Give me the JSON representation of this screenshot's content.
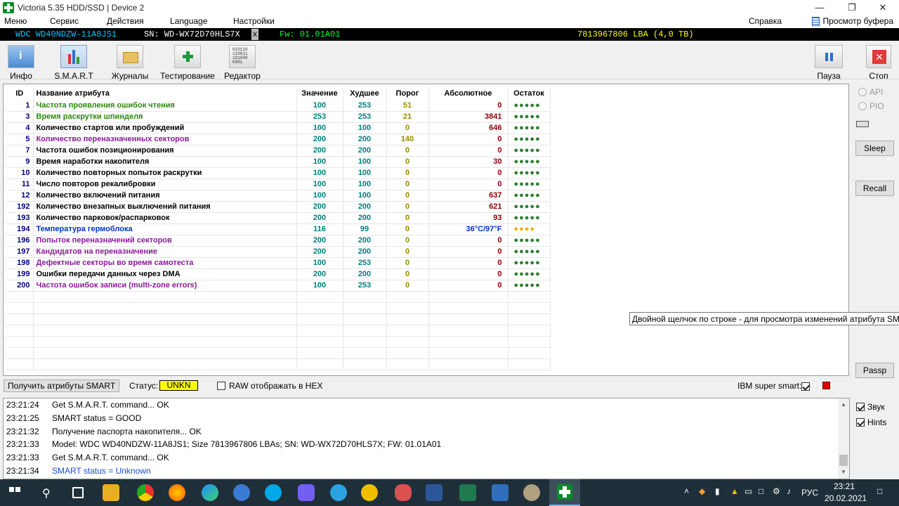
{
  "window": {
    "title": "Victoria 5.35 HDD/SSD | Device 2"
  },
  "menu": {
    "items": [
      "Меню",
      "Сервис",
      "Действия",
      "Language",
      "Настройки",
      "Справка"
    ],
    "viewer": "Просмотр буфера"
  },
  "device": {
    "model": "WDC WD40NDZW-11A8JS1",
    "serial": "SN: WD-WX72D70HLS7X",
    "close": "x",
    "firmware": "Fw: 01.01A01",
    "lba": "7813967806 LBA (4,0 TB)"
  },
  "toolbar": {
    "info": "Инфо",
    "smart": "S.M.A.R.T",
    "logs": "Журналы",
    "testing": "Тестирование",
    "editor": "Редактор",
    "pause": "Пауза",
    "stop": "Стоп"
  },
  "table": {
    "headers": [
      "ID",
      "Название атрибута",
      "Значение",
      "Худшее",
      "Порог",
      "Абсолютное",
      "Остаток"
    ],
    "rows": [
      {
        "id": "1",
        "name": "Частота проявления ошибок чтения",
        "color": "green",
        "value": "100",
        "worst": "253",
        "threshold": "51",
        "raw": "0",
        "remain": "●●●●●"
      },
      {
        "id": "3",
        "name": "Время раскрутки шпинделя",
        "color": "green",
        "value": "253",
        "worst": "253",
        "threshold": "21",
        "raw": "3841",
        "remain": "●●●●●"
      },
      {
        "id": "4",
        "name": "Количество стартов или пробуждений",
        "color": "black",
        "value": "100",
        "worst": "100",
        "threshold": "0",
        "raw": "646",
        "remain": "●●●●●"
      },
      {
        "id": "5",
        "name": "Количество переназначенных секторов",
        "color": "purple",
        "value": "200",
        "worst": "200",
        "threshold": "140",
        "raw": "0",
        "remain": "●●●●●"
      },
      {
        "id": "7",
        "name": "Частота ошибок позиционирования",
        "color": "black",
        "value": "200",
        "worst": "200",
        "threshold": "0",
        "raw": "0",
        "remain": "●●●●●"
      },
      {
        "id": "9",
        "name": "Время наработки накопителя",
        "color": "black",
        "value": "100",
        "worst": "100",
        "threshold": "0",
        "raw": "30",
        "remain": "●●●●●"
      },
      {
        "id": "10",
        "name": "Количество повторных попыток раскрутки",
        "color": "black",
        "value": "100",
        "worst": "100",
        "threshold": "0",
        "raw": "0",
        "remain": "●●●●●"
      },
      {
        "id": "11",
        "name": "Число повторов рекалибровки",
        "color": "black",
        "value": "100",
        "worst": "100",
        "threshold": "0",
        "raw": "0",
        "remain": "●●●●●"
      },
      {
        "id": "12",
        "name": "Количество включений питания",
        "color": "black",
        "value": "100",
        "worst": "100",
        "threshold": "0",
        "raw": "637",
        "remain": "●●●●●"
      },
      {
        "id": "192",
        "name": "Количество внезапных выключений питания",
        "color": "black",
        "value": "200",
        "worst": "200",
        "threshold": "0",
        "raw": "621",
        "remain": "●●●●●"
      },
      {
        "id": "193",
        "name": "Количество парковок/распарковок",
        "color": "black",
        "value": "200",
        "worst": "200",
        "threshold": "0",
        "raw": "93",
        "remain": "●●●●●"
      },
      {
        "id": "194",
        "name": "Температура гермоблока",
        "color": "blue",
        "value": "116",
        "worst": "99",
        "threshold": "0",
        "raw": "36°C/97°F",
        "remain": "●●●●"
      },
      {
        "id": "196",
        "name": "Попыток переназначений секторов",
        "color": "purple",
        "value": "200",
        "worst": "200",
        "threshold": "0",
        "raw": "0",
        "remain": "●●●●●"
      },
      {
        "id": "197",
        "name": "Кандидатов на переназначение",
        "color": "purple",
        "value": "200",
        "worst": "200",
        "threshold": "0",
        "raw": "0",
        "remain": "●●●●●"
      },
      {
        "id": "198",
        "name": "Дефектные секторы во время самотеста",
        "color": "purple",
        "value": "100",
        "worst": "253",
        "threshold": "0",
        "raw": "0",
        "remain": "●●●●●"
      },
      {
        "id": "199",
        "name": "Ошибки передачи данных через DMA",
        "color": "black",
        "value": "200",
        "worst": "200",
        "threshold": "0",
        "raw": "0",
        "remain": "●●●●●"
      },
      {
        "id": "200",
        "name": "Частота ошибок записи (multi-zone errors)",
        "color": "purple",
        "value": "100",
        "worst": "253",
        "threshold": "0",
        "raw": "0",
        "remain": "●●●●●"
      }
    ]
  },
  "right_panel": {
    "api": "API",
    "pio": "PIO",
    "sleep": "Sleep",
    "recall": "Recall",
    "passp": "Passp"
  },
  "tooltip": "Двойной щелчок по строке - для просмотра изменений атрибута SMART",
  "statusbar": {
    "get_smart": "Получить атрибуты SMART",
    "status_label": "Статус:",
    "status_value": "UNKN",
    "raw_hex": "RAW отображать в HEX",
    "ibm_label": "IBM super smart:"
  },
  "log": [
    {
      "time": "23:21:24",
      "text": "Get S.M.A.R.T. command... OK",
      "color": "#000000"
    },
    {
      "time": "23:21:25",
      "text": "SMART status = GOOD",
      "color": "#000000"
    },
    {
      "time": "23:21:32",
      "text": "Получение паспорта накопителя... OK",
      "color": "#000000"
    },
    {
      "time": "23:21:33",
      "text": "Model: WDC WD40NDZW-11A8JS1; Size 7813967806 LBAs; SN: WD-WX72D70HLS7X; FW: 01.01A01",
      "color": "#000000"
    },
    {
      "time": "23:21:33",
      "text": "Get S.M.A.R.T. command... OK",
      "color": "#000000"
    },
    {
      "time": "23:21:34",
      "text": "SMART status = Unknown",
      "color": "#1a4fd8"
    }
  ],
  "side_options": {
    "sound": "Звук",
    "hints": "Hints"
  },
  "taskbar": {
    "lang": "РУС",
    "time": "23:21",
    "date": "20.02.2021"
  },
  "colors": {
    "status_badge": "#ffff00",
    "accent_green": "#0a8a2a",
    "device_model": "#00c8ff",
    "device_firmware": "#00ff40",
    "device_lba": "#ffff00"
  }
}
